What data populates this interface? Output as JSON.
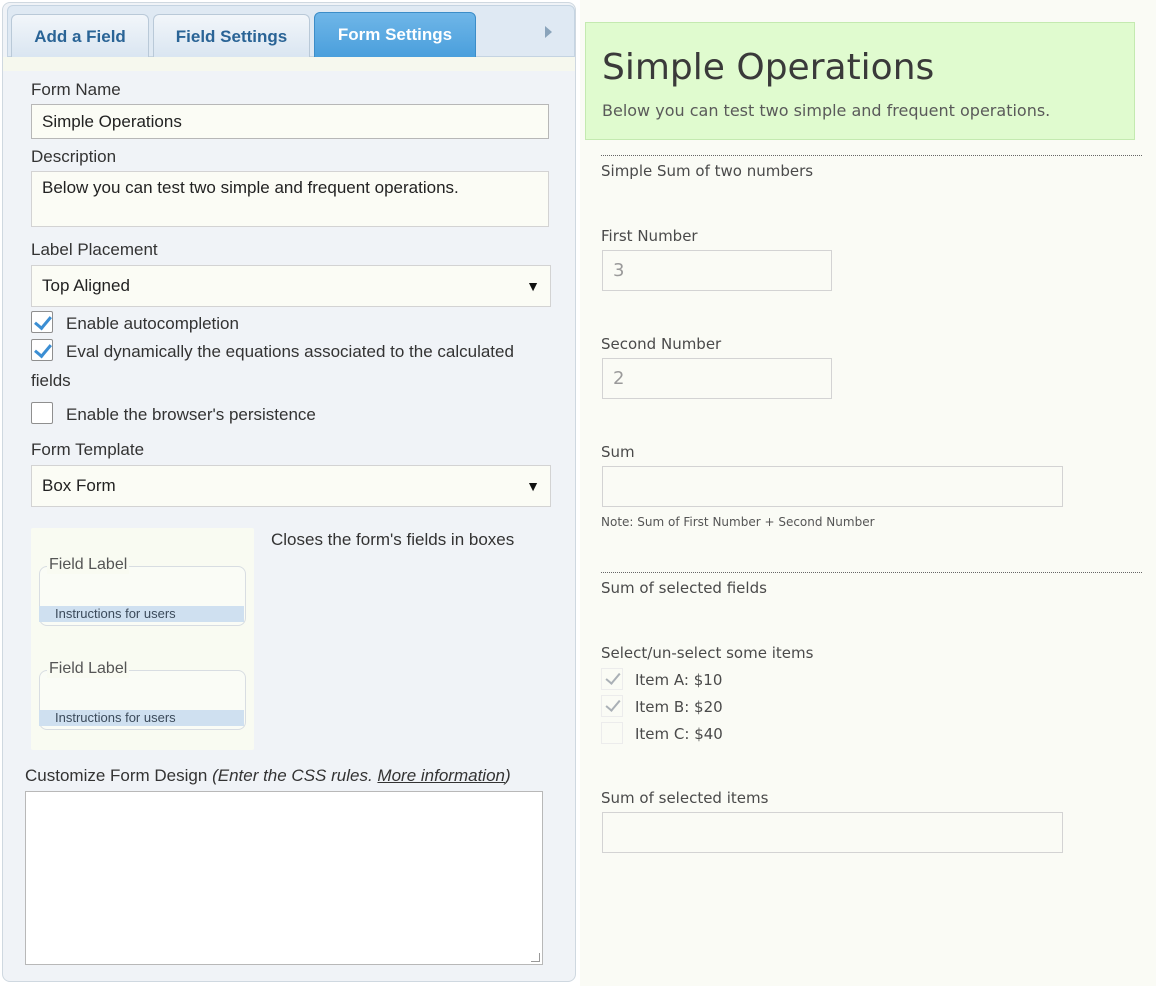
{
  "tabs": {
    "add_field": "Add a Field",
    "field_settings": "Field Settings",
    "form_settings": "Form Settings"
  },
  "settings": {
    "form_name_label": "Form Name",
    "form_name_value": "Simple Operations",
    "description_label": "Description",
    "description_value": "Below you can test two simple and frequent operations.",
    "label_placement_label": "Label Placement",
    "label_placement_value": "Top Aligned",
    "autocompletion_label": "Enable autocompletion",
    "autocompletion_checked": true,
    "eval_label_line1": "Eval dynamically the equations associated to the calculated",
    "eval_label_line2": "fields",
    "eval_checked": true,
    "persistence_label": "Enable the browser's persistence",
    "persistence_checked": false,
    "form_template_label": "Form Template",
    "form_template_value": "Box Form",
    "template_description": "Closes the form's fields in boxes",
    "template_preview": {
      "field_label_1": "Field Label",
      "instructions_1": "Instructions for users",
      "field_label_2": "Field Label",
      "instructions_2": "Instructions for users"
    },
    "customize_label": "Customize Form Design",
    "customize_hint": "(Enter the CSS rules.",
    "more_info_link": "More information",
    "customize_hint_end": ")",
    "css_value": ""
  },
  "preview": {
    "title": "Simple Operations",
    "description": "Below you can test two simple and frequent operations.",
    "section1_title": "Simple Sum of two numbers",
    "first_number_label": "First Number",
    "first_number_value": "3",
    "second_number_label": "Second Number",
    "second_number_value": "2",
    "sum_label": "Sum",
    "sum_value": "",
    "sum_note": "Note: Sum of First Number + Second Number",
    "section2_title": "Sum of selected fields",
    "select_label": "Select/un-select some items",
    "items": [
      {
        "label": "Item A: $10",
        "checked": true
      },
      {
        "label": "Item B: $20",
        "checked": true
      },
      {
        "label": "Item C: $40",
        "checked": false
      }
    ],
    "sum_selected_label": "Sum of selected items",
    "sum_selected_value": ""
  },
  "colors": {
    "active_tab": "#4a9fdc",
    "tab_text": "#2a6496",
    "header_bg": "#e0fbcf",
    "checkbox_tick": "#3b8ed3"
  }
}
